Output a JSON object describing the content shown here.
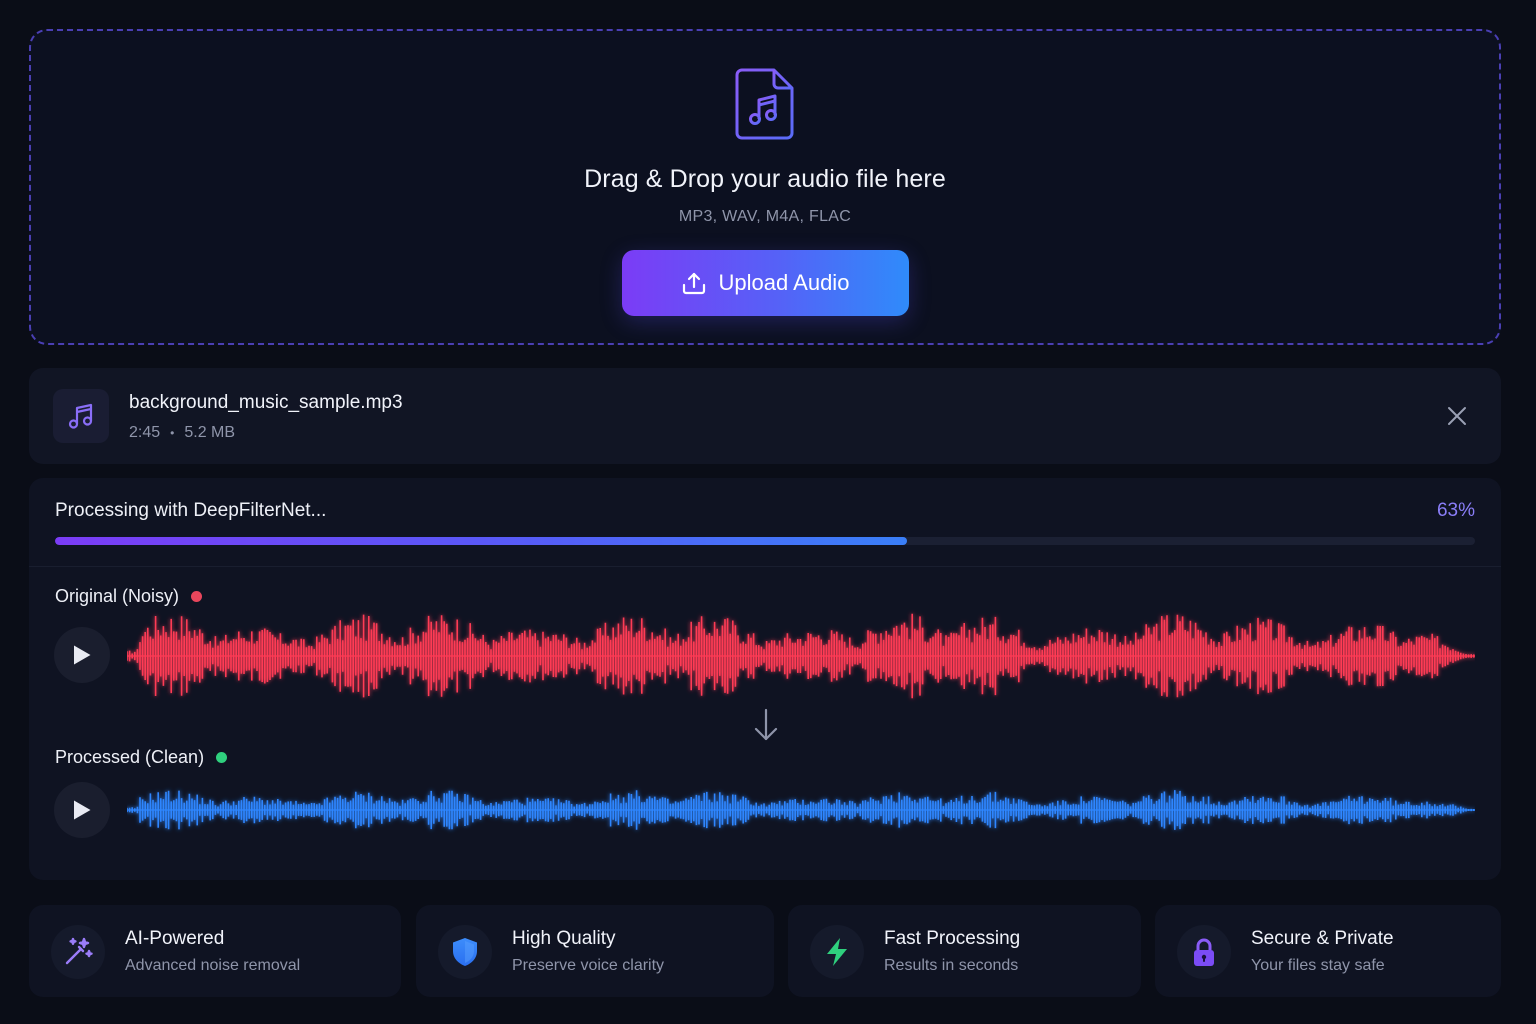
{
  "dropzone": {
    "title": "Drag & Drop your audio file here",
    "formats": "MP3, WAV, M4A, FLAC",
    "upload_label": "Upload Audio"
  },
  "file": {
    "name": "background_music_sample.mp3",
    "duration": "2:45",
    "separator": "•",
    "size": "5.2 MB"
  },
  "processing": {
    "label": "Processing with DeepFilterNet...",
    "percent_label": "63%",
    "progress": 0.6
  },
  "tracks": {
    "original": {
      "label": "Original (Noisy)",
      "color": "#e8465c"
    },
    "processed": {
      "label": "Processed (Clean)",
      "color": "#2fd07e"
    }
  },
  "colors": {
    "accent_purple": "#7b3cf6",
    "accent_blue": "#2f8bfa",
    "noisy_wave": "#ff3b55",
    "clean_wave": "#2f86ff"
  },
  "features": [
    {
      "icon": "magic-wand-icon",
      "title": "AI-Powered",
      "subtitle": "Advanced noise removal"
    },
    {
      "icon": "shield-icon",
      "title": "High Quality",
      "subtitle": "Preserve voice clarity"
    },
    {
      "icon": "lightning-icon",
      "title": "Fast Processing",
      "subtitle": "Results in seconds"
    },
    {
      "icon": "lock-icon",
      "title": "Secure & Private",
      "subtitle": "Your files stay safe"
    }
  ]
}
